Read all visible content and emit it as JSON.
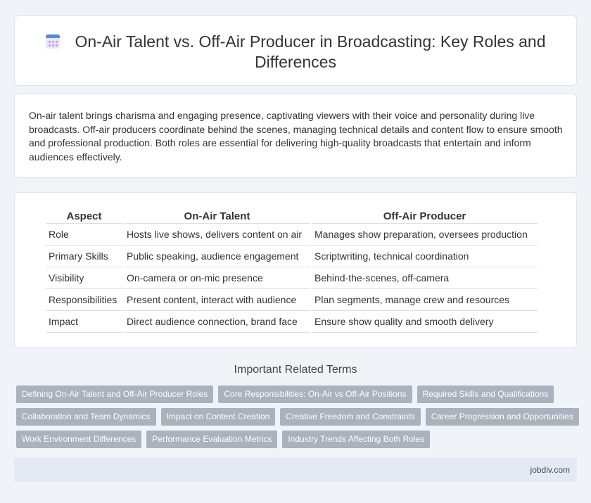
{
  "header": {
    "title": "On-Air Talent vs. Off-Air Producer in Broadcasting: Key Roles and Differences",
    "icon": "calendar-icon"
  },
  "intro": {
    "text": "On-air talent brings charisma and engaging presence, captivating viewers with their voice and personality during live broadcasts. Off-air producers coordinate behind the scenes, managing technical details and content flow to ensure smooth and professional production. Both roles are essential for delivering high-quality broadcasts that entertain and inform audiences effectively."
  },
  "comparison": {
    "headers": [
      "Aspect",
      "On-Air Talent",
      "Off-Air Producer"
    ],
    "rows": [
      [
        "Role",
        "Hosts live shows, delivers content on air",
        "Manages show preparation, oversees production"
      ],
      [
        "Primary Skills",
        "Public speaking, audience engagement",
        "Scriptwriting, technical coordination"
      ],
      [
        "Visibility",
        "On-camera or on-mic presence",
        "Behind-the-scenes, off-camera"
      ],
      [
        "Responsibilities",
        "Present content, interact with audience",
        "Plan segments, manage crew and resources"
      ],
      [
        "Impact",
        "Direct audience connection, brand face",
        "Ensure show quality and smooth delivery"
      ]
    ]
  },
  "related": {
    "title": "Important Related Terms",
    "tags": [
      "Defining On-Air Talent and Off-Air Producer Roles",
      "Core Responsibilities: On-Air vs Off-Air Positions",
      "Required Skills and Qualifications",
      "Collaboration and Team Dynamics",
      "Impact on Content Creation",
      "Creative Freedom and Constraints",
      "Career Progression and Opportunities",
      "Work Environment Differences",
      "Performance Evaluation Metrics",
      "Industry Trends Affecting Both Roles"
    ]
  },
  "footer": {
    "site": "jobdiv.com"
  },
  "colors": {
    "background": "#f0f3f8",
    "tag": "#a9b2bd",
    "footer": "#e4eaf4",
    "icon_accent": "#4a8fe0"
  }
}
